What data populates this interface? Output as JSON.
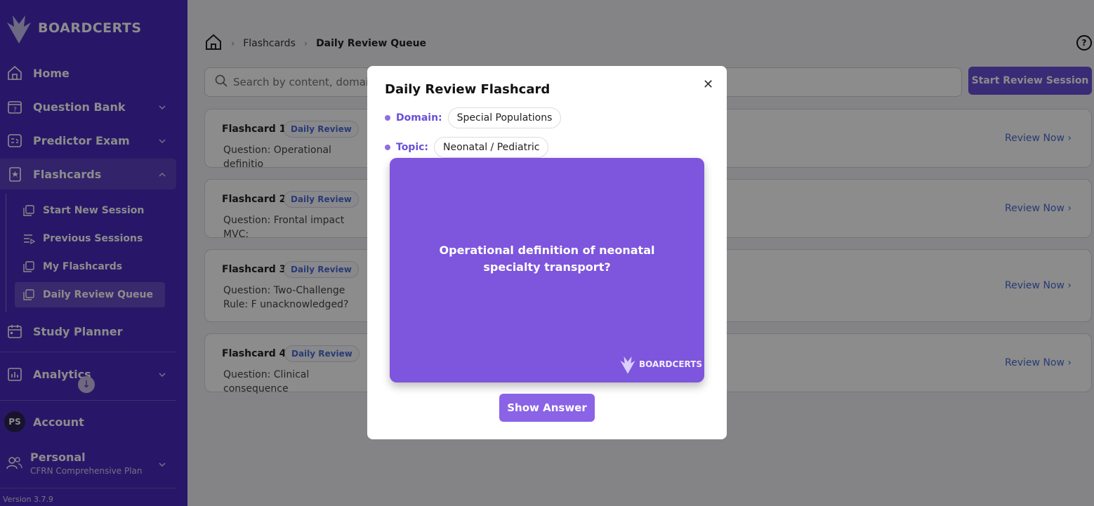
{
  "brand": {
    "name": "BOARDCERTS"
  },
  "sidebar": {
    "items": [
      {
        "label": "Home",
        "icon": "home-icon"
      },
      {
        "label": "Question Bank",
        "icon": "question-bank-icon"
      },
      {
        "label": "Predictor Exam",
        "icon": "predictor-exam-icon"
      },
      {
        "label": "Flashcards",
        "icon": "flashcards-icon"
      },
      {
        "label": "Study Planner",
        "icon": "calendar-icon"
      },
      {
        "label": "Analytics",
        "icon": "analytics-icon"
      }
    ],
    "flashcards_sub": [
      {
        "label": "Start New Session",
        "icon": "cards-icon"
      },
      {
        "label": "Previous Sessions",
        "icon": "list-play-icon"
      },
      {
        "label": "My Flashcards",
        "icon": "cards-icon"
      },
      {
        "label": "Daily Review Queue",
        "icon": "cards-icon"
      }
    ],
    "account": {
      "initials": "PS",
      "label": "Account"
    },
    "plan": {
      "title": "Personal",
      "subtitle": "CFRN Comprehensive Plan"
    },
    "version": "Version 3.7.9"
  },
  "breadcrumb": {
    "items": [
      "Flashcards",
      "Daily Review Queue"
    ]
  },
  "search": {
    "placeholder": "Search by content, domain"
  },
  "start_button": "Start Review Session",
  "cards": [
    {
      "title": "Flashcard 1",
      "badge": "Daily Review",
      "question": "Question: Operational definitio",
      "action": "Review Now"
    },
    {
      "title": "Flashcard 2",
      "badge": "Daily Review",
      "question": "Question: Frontal impact MVC:",
      "action": "Review Now"
    },
    {
      "title": "Flashcard 3",
      "badge": "Daily Review",
      "question": "Question: Two-Challenge Rule: F unacknowledged?",
      "action": "Review Now"
    },
    {
      "title": "Flashcard 4",
      "badge": "Daily Review",
      "question": "Question: Clinical consequence",
      "action": "Review Now"
    }
  ],
  "modal": {
    "title": "Daily Review Flashcard",
    "domain_label": "Domain:",
    "domain_value": "Special Populations",
    "topic_label": "Topic:",
    "topic_value": "Neonatal / Pediatric",
    "question": "Operational definition of neonatal specialty transport?",
    "card_brand": "BOARDCERTS",
    "show_answer": "Show Answer"
  },
  "colors": {
    "sidebar": "#4a2bbd",
    "accent": "#6a4fd8",
    "card": "#7e55dd",
    "link": "#4a6cd4"
  }
}
